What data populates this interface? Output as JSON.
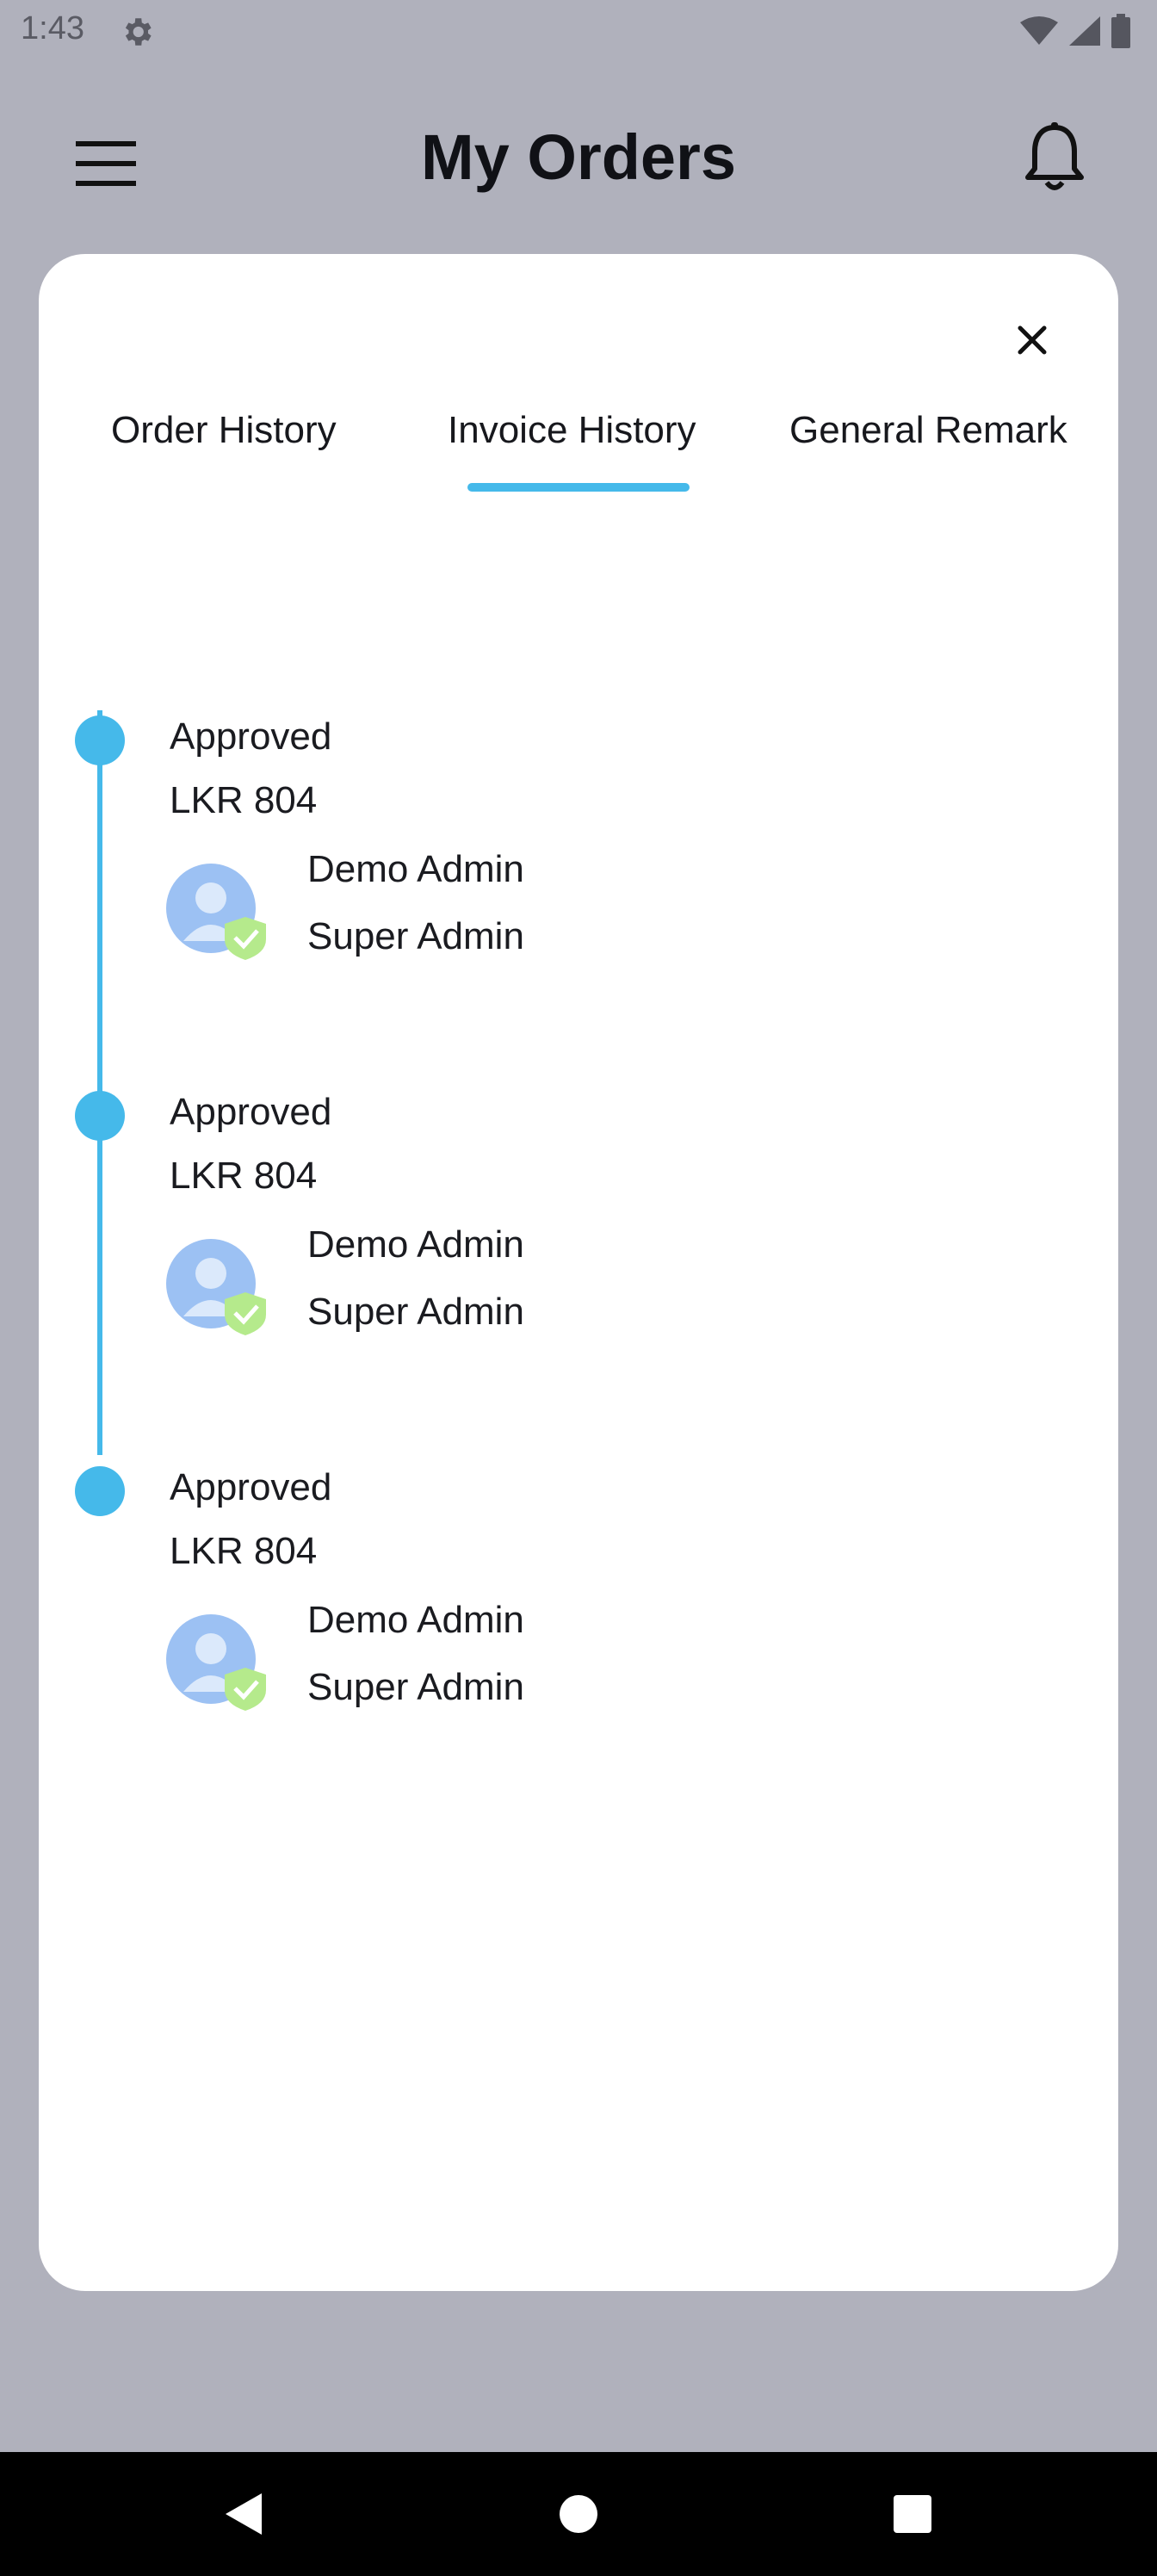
{
  "status_bar": {
    "time": "1:43",
    "icons": [
      "gear-icon",
      "wifi-icon",
      "cellular-icon",
      "battery-icon"
    ]
  },
  "app_bar": {
    "title": "My Orders",
    "icons": [
      "hamburger-menu-icon",
      "bell-icon"
    ]
  },
  "modal": {
    "close_icon": "close-icon",
    "tabs": [
      {
        "label": "Order History",
        "selected": false
      },
      {
        "label": "Invoice History",
        "selected": true
      },
      {
        "label": "General Remark",
        "selected": false
      }
    ],
    "entries": [
      {
        "status": "Approved",
        "amount": "LKR 804",
        "name": "Demo Admin",
        "role": "Super Admin"
      },
      {
        "status": "Approved",
        "amount": "LKR 804",
        "name": "Demo Admin",
        "role": "Super Admin"
      },
      {
        "status": "Approved",
        "amount": "LKR 804",
        "name": "Demo Admin",
        "role": "Super Admin"
      }
    ]
  },
  "colors": {
    "accent": "#45b9ea",
    "backdrop": "#b0b1bc",
    "card": "#ffffff",
    "nav_bar": "#000000"
  },
  "nav_bar": {
    "buttons": [
      "back-icon",
      "home-icon",
      "recents-icon"
    ]
  }
}
